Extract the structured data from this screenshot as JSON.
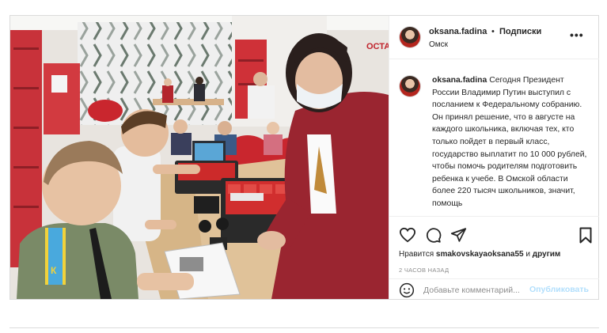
{
  "post": {
    "username": "oksana.fadina",
    "separator": "•",
    "follow_label": "Подписки",
    "location": "Омск",
    "more_label": "•••",
    "caption_username": "oksana.fadina",
    "caption_text": "Сегодня Президент России Владимир Путин выступил с посланием к Федеральному собранию. Он принял решение, что в августе на каждого школьника, включая тех, кто только пойдет в первый класс, государство выплатит по 10 000 рублей, чтобы помочь родителям подготовить ребенка к учебе. В Омской области более 220 тысяч школьников, значит, помощь",
    "likes_prefix": "Нравится",
    "likes_user": "smakovskayaoksana55",
    "likes_and": "и",
    "likes_others": "другим",
    "timestamp": "2 ЧАСОВ НАЗАД",
    "comment_placeholder": "Добавьте комментарий...",
    "publish_label": "Опубликовать"
  },
  "icons": {
    "like": "heart-icon",
    "comment": "comment-icon",
    "share": "paper-plane-icon",
    "save": "bookmark-icon",
    "emoji": "emoji-icon",
    "more": "more-dots-icon"
  },
  "colors": {
    "text": "#262626",
    "muted": "#8e8e8e",
    "border": "#dbdbdb",
    "publish_disabled": "#b2dffc",
    "jacket": "#9a2530"
  },
  "photo_labels": {
    "badge_letter": "К",
    "wall_sign": "ОСТА"
  }
}
